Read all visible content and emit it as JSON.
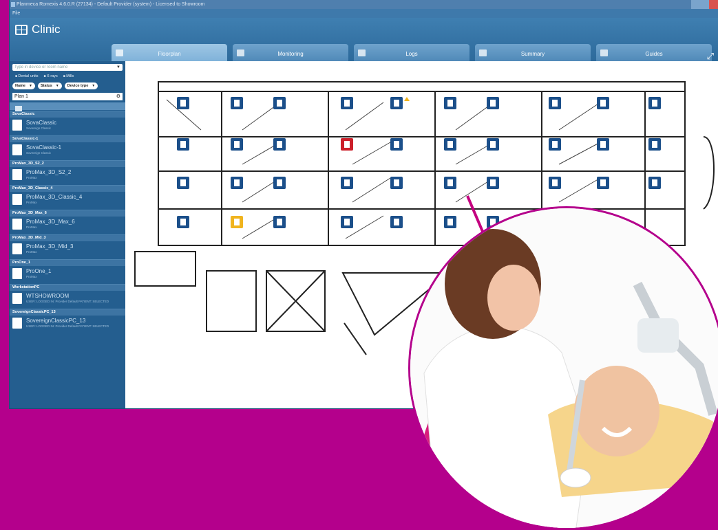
{
  "window": {
    "title": "Planmeca Romexis 4.6.0.R (27134) - Default Provider (system) - Licensed to Showroom"
  },
  "menu": {
    "label": "File"
  },
  "app": {
    "title": "Clinic"
  },
  "tabs": [
    {
      "label": "Floorplan",
      "icon": "floorplan-icon",
      "active": true
    },
    {
      "label": "Monitoring",
      "icon": "monitor-icon",
      "active": false
    },
    {
      "label": "Logs",
      "icon": "logs-icon",
      "active": false
    },
    {
      "label": "Summary",
      "icon": "chart-icon",
      "active": false
    },
    {
      "label": "Guides",
      "icon": "guides-icon",
      "active": false
    }
  ],
  "sidebar": {
    "search_placeholder": "Type in device or room name",
    "filters": [
      "Dental units",
      "X-rays",
      "Mills"
    ],
    "selects": [
      "Name",
      "Status",
      "Device type"
    ],
    "plan": "Plan 1",
    "groups": [
      {
        "header": "SovaClassic",
        "name": "SovaClassic",
        "sub": "Sovereign Classic"
      },
      {
        "header": "SovaClassic-1",
        "name": "SovaClassic-1",
        "sub": "Sovereign Classic"
      },
      {
        "header": "ProMax_3D_S2_2",
        "name": "ProMax_3D_S2_2",
        "sub": "ProMax"
      },
      {
        "header": "ProMax_3D_Classic_4",
        "name": "ProMax_3D_Classic_4",
        "sub": "ProMax"
      },
      {
        "header": "ProMax_3D_Max_6",
        "name": "ProMax_3D_Max_6",
        "sub": "ProMax"
      },
      {
        "header": "ProMax_3D_Mid_3",
        "name": "ProMax_3D_Mid_3",
        "sub": "ProMax"
      },
      {
        "header": "ProOne_1",
        "name": "ProOne_1",
        "sub": "ProMax"
      },
      {
        "header": "WorkstationPC",
        "name": "WTSHOWROOM",
        "sub": "USER: LOGGED IN: Provider Default PATIENT: SELECTED"
      },
      {
        "header": "SovereignClassicPC_13",
        "name": "SovereignClassicPC_13",
        "sub": "USER: LOGGED IN: Provider Default PATIENT: SELECTED"
      }
    ]
  },
  "floorplan": {
    "status_colors": {
      "normal": "#1b4f8a",
      "error": "#cc1f2a",
      "warning": "#f0b41e"
    },
    "units": [
      {
        "type": "dental-unit",
        "status": "normal"
      },
      {
        "type": "dental-unit",
        "status": "normal"
      },
      {
        "type": "dental-unit",
        "status": "normal"
      },
      {
        "type": "dental-unit",
        "status": "normal"
      },
      {
        "type": "xray-unit",
        "status": "warning-flag"
      },
      {
        "type": "xray-unit",
        "status": "normal"
      },
      {
        "type": "xray-unit",
        "status": "normal"
      },
      {
        "type": "dental-unit",
        "status": "normal"
      },
      {
        "type": "dental-unit",
        "status": "normal"
      },
      {
        "type": "workstation",
        "status": "normal"
      },
      {
        "type": "workstation",
        "status": "normal"
      },
      {
        "type": "dental-unit",
        "status": "normal"
      },
      {
        "type": "dental-unit",
        "status": "normal"
      },
      {
        "type": "dental-unit",
        "status": "error"
      },
      {
        "type": "xray-unit",
        "status": "normal"
      },
      {
        "type": "xray-unit",
        "status": "normal"
      },
      {
        "type": "xray-unit",
        "status": "normal"
      },
      {
        "type": "dental-unit",
        "status": "normal"
      },
      {
        "type": "dental-unit",
        "status": "normal"
      },
      {
        "type": "workstation",
        "status": "normal"
      },
      {
        "type": "workstation",
        "status": "normal"
      },
      {
        "type": "dental-unit",
        "status": "normal"
      },
      {
        "type": "dental-unit",
        "status": "normal"
      },
      {
        "type": "dental-unit",
        "status": "normal"
      },
      {
        "type": "dental-unit",
        "status": "normal"
      },
      {
        "type": "dental-unit",
        "status": "normal"
      },
      {
        "type": "dental-unit",
        "status": "normal"
      },
      {
        "type": "dental-unit",
        "status": "normal"
      },
      {
        "type": "workstation",
        "status": "normal"
      },
      {
        "type": "workstation",
        "status": "normal"
      },
      {
        "type": "workstation",
        "status": "normal"
      },
      {
        "type": "dental-unit",
        "status": "warning"
      },
      {
        "type": "dental-unit",
        "status": "normal"
      },
      {
        "type": "dental-unit",
        "status": "normal"
      },
      {
        "type": "dental-unit",
        "status": "normal"
      },
      {
        "type": "dental-unit",
        "status": "normal"
      },
      {
        "type": "dental-unit",
        "status": "normal"
      }
    ]
  },
  "colors": {
    "brand": "#b4008c",
    "toolbar": "#2f6f9f",
    "accent": "#1b4f8a"
  }
}
